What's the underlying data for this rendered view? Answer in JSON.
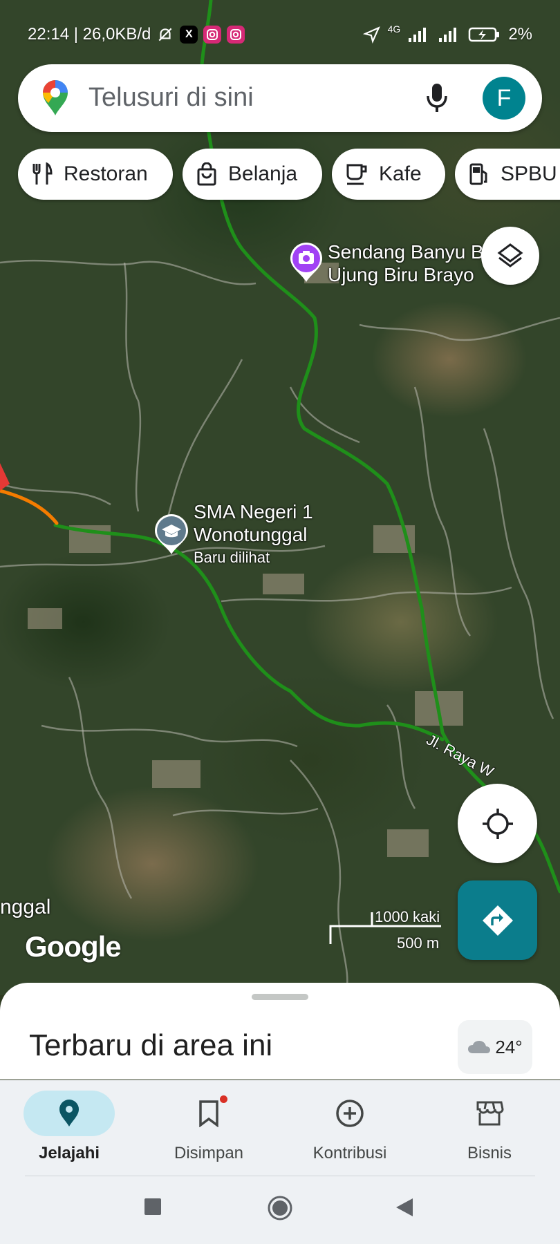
{
  "status_bar": {
    "time_speed": "22:14 | 26,0KB/d",
    "battery": "2%",
    "network": "4G",
    "apps": [
      "X",
      "Instagram",
      "Instagram"
    ]
  },
  "search": {
    "placeholder": "Telusuri di sini",
    "avatar_letter": "F"
  },
  "chips": [
    {
      "label": "Restoran",
      "icon": "fork-knife-icon"
    },
    {
      "label": "Belanja",
      "icon": "shopping-bag-icon"
    },
    {
      "label": "Kafe",
      "icon": "coffee-cup-icon"
    },
    {
      "label": "SPBU",
      "icon": "gas-station-icon"
    }
  ],
  "map": {
    "places": [
      {
        "name_line1": "Sendang Banyu Bi",
        "name_line2": "Ujung Biru Brayo",
        "icon": "camera-icon",
        "color": "#a142f4"
      },
      {
        "name_line1": "SMA Negeri 1",
        "name_line2": "Wonotunggal",
        "note": "Baru dilihat",
        "icon": "school-icon",
        "color": "#5f7a8c"
      }
    ],
    "edge_label": "nggal",
    "road_label": "Jl. Raya W",
    "scale": {
      "imperial": "1000 kaki",
      "metric": "500 m"
    },
    "attribution": "Google"
  },
  "bottom_sheet": {
    "title": "Terbaru di area ini",
    "weather_temp": "24°"
  },
  "nav": {
    "items": [
      {
        "label": "Jelajahi",
        "icon": "explore-pin-icon",
        "active": true
      },
      {
        "label": "Disimpan",
        "icon": "bookmark-icon",
        "active": false
      },
      {
        "label": "Kontribusi",
        "icon": "add-circle-icon",
        "active": false
      },
      {
        "label": "Bisnis",
        "icon": "storefront-icon",
        "active": false
      }
    ]
  },
  "colors": {
    "route_green": "#1f8f1a",
    "route_orange": "#f57c00",
    "accent_teal": "#0b7d8c",
    "avatar_teal": "#00838f"
  }
}
